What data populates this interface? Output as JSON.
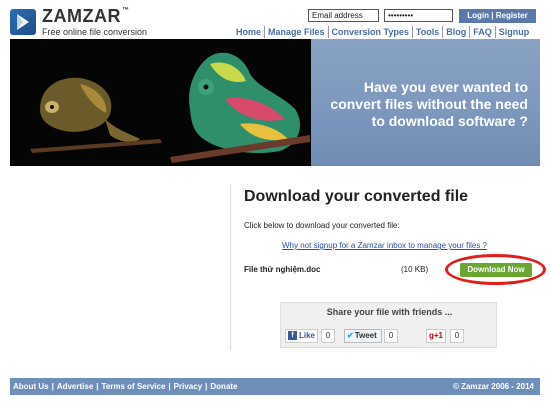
{
  "header": {
    "brand": "ZAMZAR",
    "brand_tm": "™",
    "tagline": "Free online file conversion",
    "email_placeholder": "Email address",
    "password_value": "•••••••••",
    "login_label": "Login | Register"
  },
  "nav": {
    "items": [
      "Home",
      "Manage Files",
      "Conversion Types",
      "Tools",
      "Blog",
      "FAQ",
      "Signup"
    ]
  },
  "banner": {
    "line1": "Have you ever wanted to",
    "line2": "convert files without the need",
    "line3": "to download software ?"
  },
  "download": {
    "title": "Download your converted file",
    "instruction": "Click below to download your converted file:",
    "signup_link": "Why not signup for a Zamzar inbox to manage your files ?",
    "file_name": "File thử nghiệm.doc",
    "file_size": "(10 KB)",
    "button_label": "Download Now"
  },
  "share": {
    "title": "Share your file with friends ...",
    "facebook_label": "Like",
    "facebook_count": "0",
    "twitter_label": "Tweet",
    "twitter_count": "0",
    "gplus_label": "+1",
    "gplus_count": "0"
  },
  "footer": {
    "links": [
      "About Us",
      "Advertise",
      "Terms of Service",
      "Privacy",
      "Donate"
    ],
    "copyright": "© Zamzar 2006 - 2014"
  },
  "colors": {
    "nav_link": "#4b6fa0",
    "footer_bg": "#6f8fbb",
    "download_button": "#6aa531",
    "highlight": "#e01d1d"
  }
}
